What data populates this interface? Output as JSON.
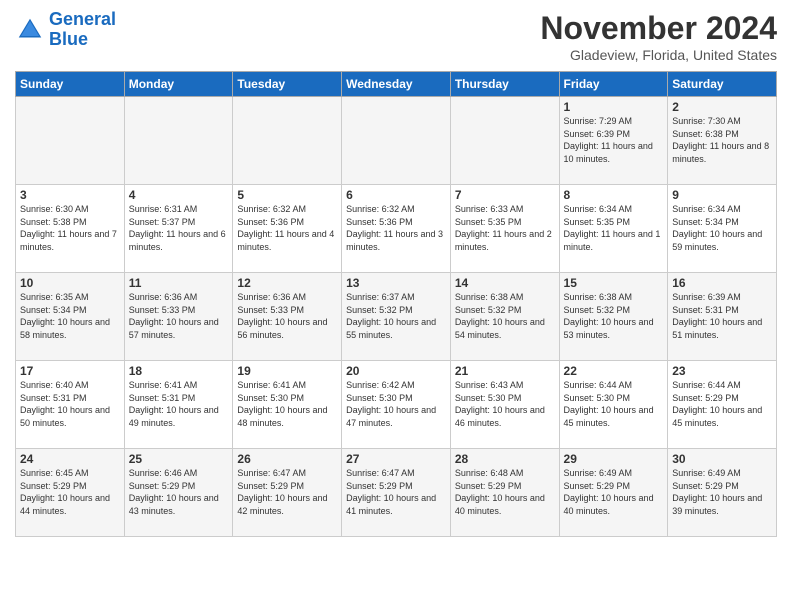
{
  "logo": {
    "line1": "General",
    "line2": "Blue"
  },
  "header": {
    "month_year": "November 2024",
    "location": "Gladeview, Florida, United States"
  },
  "weekdays": [
    "Sunday",
    "Monday",
    "Tuesday",
    "Wednesday",
    "Thursday",
    "Friday",
    "Saturday"
  ],
  "weeks": [
    [
      {
        "day": "",
        "info": ""
      },
      {
        "day": "",
        "info": ""
      },
      {
        "day": "",
        "info": ""
      },
      {
        "day": "",
        "info": ""
      },
      {
        "day": "",
        "info": ""
      },
      {
        "day": "1",
        "info": "Sunrise: 7:29 AM\nSunset: 6:39 PM\nDaylight: 11 hours and 10 minutes."
      },
      {
        "day": "2",
        "info": "Sunrise: 7:30 AM\nSunset: 6:38 PM\nDaylight: 11 hours and 8 minutes."
      }
    ],
    [
      {
        "day": "3",
        "info": "Sunrise: 6:30 AM\nSunset: 5:38 PM\nDaylight: 11 hours and 7 minutes."
      },
      {
        "day": "4",
        "info": "Sunrise: 6:31 AM\nSunset: 5:37 PM\nDaylight: 11 hours and 6 minutes."
      },
      {
        "day": "5",
        "info": "Sunrise: 6:32 AM\nSunset: 5:36 PM\nDaylight: 11 hours and 4 minutes."
      },
      {
        "day": "6",
        "info": "Sunrise: 6:32 AM\nSunset: 5:36 PM\nDaylight: 11 hours and 3 minutes."
      },
      {
        "day": "7",
        "info": "Sunrise: 6:33 AM\nSunset: 5:35 PM\nDaylight: 11 hours and 2 minutes."
      },
      {
        "day": "8",
        "info": "Sunrise: 6:34 AM\nSunset: 5:35 PM\nDaylight: 11 hours and 1 minute."
      },
      {
        "day": "9",
        "info": "Sunrise: 6:34 AM\nSunset: 5:34 PM\nDaylight: 10 hours and 59 minutes."
      }
    ],
    [
      {
        "day": "10",
        "info": "Sunrise: 6:35 AM\nSunset: 5:34 PM\nDaylight: 10 hours and 58 minutes."
      },
      {
        "day": "11",
        "info": "Sunrise: 6:36 AM\nSunset: 5:33 PM\nDaylight: 10 hours and 57 minutes."
      },
      {
        "day": "12",
        "info": "Sunrise: 6:36 AM\nSunset: 5:33 PM\nDaylight: 10 hours and 56 minutes."
      },
      {
        "day": "13",
        "info": "Sunrise: 6:37 AM\nSunset: 5:32 PM\nDaylight: 10 hours and 55 minutes."
      },
      {
        "day": "14",
        "info": "Sunrise: 6:38 AM\nSunset: 5:32 PM\nDaylight: 10 hours and 54 minutes."
      },
      {
        "day": "15",
        "info": "Sunrise: 6:38 AM\nSunset: 5:32 PM\nDaylight: 10 hours and 53 minutes."
      },
      {
        "day": "16",
        "info": "Sunrise: 6:39 AM\nSunset: 5:31 PM\nDaylight: 10 hours and 51 minutes."
      }
    ],
    [
      {
        "day": "17",
        "info": "Sunrise: 6:40 AM\nSunset: 5:31 PM\nDaylight: 10 hours and 50 minutes."
      },
      {
        "day": "18",
        "info": "Sunrise: 6:41 AM\nSunset: 5:31 PM\nDaylight: 10 hours and 49 minutes."
      },
      {
        "day": "19",
        "info": "Sunrise: 6:41 AM\nSunset: 5:30 PM\nDaylight: 10 hours and 48 minutes."
      },
      {
        "day": "20",
        "info": "Sunrise: 6:42 AM\nSunset: 5:30 PM\nDaylight: 10 hours and 47 minutes."
      },
      {
        "day": "21",
        "info": "Sunrise: 6:43 AM\nSunset: 5:30 PM\nDaylight: 10 hours and 46 minutes."
      },
      {
        "day": "22",
        "info": "Sunrise: 6:44 AM\nSunset: 5:30 PM\nDaylight: 10 hours and 45 minutes."
      },
      {
        "day": "23",
        "info": "Sunrise: 6:44 AM\nSunset: 5:29 PM\nDaylight: 10 hours and 45 minutes."
      }
    ],
    [
      {
        "day": "24",
        "info": "Sunrise: 6:45 AM\nSunset: 5:29 PM\nDaylight: 10 hours and 44 minutes."
      },
      {
        "day": "25",
        "info": "Sunrise: 6:46 AM\nSunset: 5:29 PM\nDaylight: 10 hours and 43 minutes."
      },
      {
        "day": "26",
        "info": "Sunrise: 6:47 AM\nSunset: 5:29 PM\nDaylight: 10 hours and 42 minutes."
      },
      {
        "day": "27",
        "info": "Sunrise: 6:47 AM\nSunset: 5:29 PM\nDaylight: 10 hours and 41 minutes."
      },
      {
        "day": "28",
        "info": "Sunrise: 6:48 AM\nSunset: 5:29 PM\nDaylight: 10 hours and 40 minutes."
      },
      {
        "day": "29",
        "info": "Sunrise: 6:49 AM\nSunset: 5:29 PM\nDaylight: 10 hours and 40 minutes."
      },
      {
        "day": "30",
        "info": "Sunrise: 6:49 AM\nSunset: 5:29 PM\nDaylight: 10 hours and 39 minutes."
      }
    ]
  ]
}
